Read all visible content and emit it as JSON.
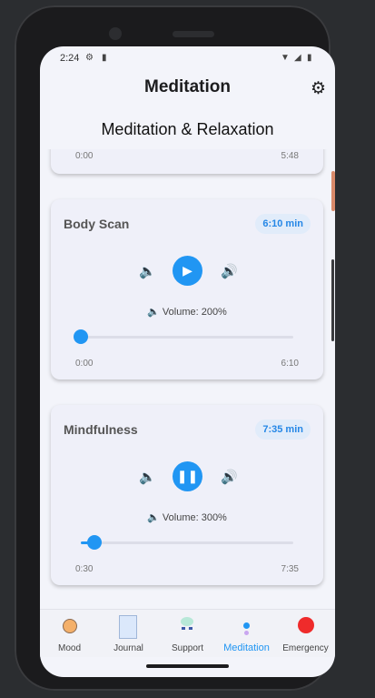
{
  "status": {
    "time": "2:24"
  },
  "header": {
    "title": "Meditation",
    "subtitle": "Meditation & Relaxation"
  },
  "partial_card": {
    "start": "0:00",
    "end": "5:48"
  },
  "cards": [
    {
      "title": "Body Scan",
      "duration": "6:10 min",
      "state": "paused",
      "volume_label": "Volume: 200%",
      "position": "0:00",
      "total": "6:10",
      "progress": 0.0
    },
    {
      "title": "Mindfulness",
      "duration": "7:35 min",
      "state": "playing",
      "volume_label": "Volume: 300%",
      "position": "0:30",
      "total": "7:35",
      "progress": 0.066
    }
  ],
  "nav": [
    {
      "label": "Mood",
      "icon": "mood-icon",
      "color": "#f4b06a",
      "active": false
    },
    {
      "label": "Journal",
      "icon": "journal-icon",
      "color": "#dbe8fb",
      "active": false
    },
    {
      "label": "Support",
      "icon": "support-icon",
      "color": "#b8e8d8",
      "active": false
    },
    {
      "label": "Meditation",
      "icon": "meditation-icon",
      "color": "#2196f3",
      "active": true
    },
    {
      "label": "Emergency",
      "icon": "emergency-icon",
      "color": "#ef2b2b",
      "active": false
    }
  ],
  "colors": {
    "accent": "#2196f3",
    "card_bg": "#eff0f9",
    "screen_bg": "#f3f4fa"
  }
}
